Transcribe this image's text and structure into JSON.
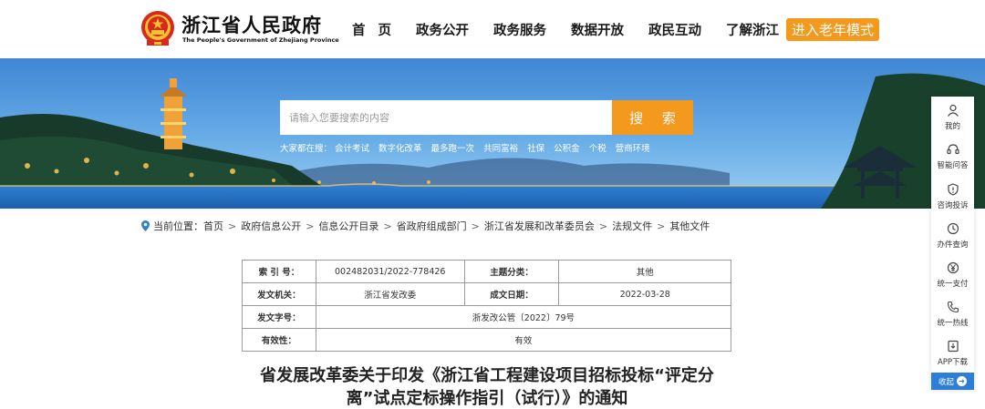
{
  "header": {
    "logo_cn": "浙江省人民政府",
    "logo_en": "The People's Government of Zhejiang Province",
    "nav": [
      "首页",
      "政务公开",
      "政务服务",
      "数据开放",
      "政民互动",
      "了解浙江"
    ],
    "elder_mode": "进入老年模式"
  },
  "search": {
    "placeholder": "请输入您要搜索的内容",
    "button": "搜 索",
    "hot_label": "大家都在搜：",
    "hot_items": [
      "会计考试",
      "数字化改革",
      "最多跑一次",
      "共同富裕",
      "社保",
      "公积金",
      "个税",
      "营商环境"
    ]
  },
  "breadcrumb": {
    "prefix": "当前位置：",
    "items": [
      "首页",
      "政府信息公开",
      "信息公开目录",
      "省政府组成部门",
      "浙江省发展和改革委员会",
      "法规文件",
      "其他文件"
    ],
    "separator": ">"
  },
  "info_table": {
    "index_no_label": "索 引 号：",
    "index_no": "002482031/2022-778426",
    "topic_label": "主题分类：",
    "topic": "其他",
    "issuer_label": "发文机关：",
    "issuer": "浙江省发改委",
    "date_label": "成文日期：",
    "date": "2022-03-28",
    "doc_no_label": "发文字号：",
    "doc_no": "浙发改公管〔2022〕79号",
    "validity_label": "有效性：",
    "validity": "有效"
  },
  "article": {
    "title": "省发展改革委关于印发《浙江省工程建设项目招标投标“评定分离”试点定标操作指引（试行）》的通知"
  },
  "sidebar": {
    "items": [
      {
        "label": "我的",
        "icon": "user-icon"
      },
      {
        "label": "智能问答",
        "icon": "headset-icon"
      },
      {
        "label": "咨询投诉",
        "icon": "shield-icon"
      },
      {
        "label": "办件查询",
        "icon": "history-icon"
      },
      {
        "label": "统一支付",
        "icon": "yen-icon"
      },
      {
        "label": "统一热线",
        "icon": "phone-icon"
      },
      {
        "label": "APP下载",
        "icon": "download-icon"
      }
    ],
    "collapse": "收起"
  },
  "colors": {
    "accent_orange": "#f39a1e",
    "sidebar_blue": "#2e7ed6"
  }
}
